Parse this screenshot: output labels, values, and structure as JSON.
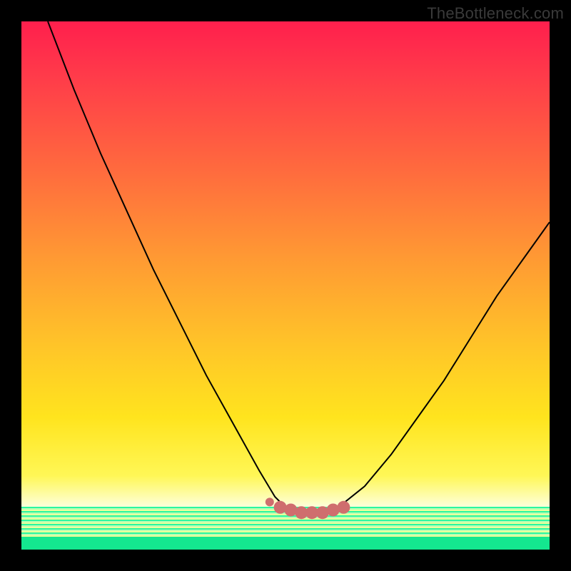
{
  "watermark": "TheBottleneck.com",
  "chart_data": {
    "type": "line",
    "title": "",
    "xlabel": "",
    "ylabel": "",
    "xlim": [
      0,
      100
    ],
    "ylim": [
      0,
      100
    ],
    "legend": false,
    "grid": false,
    "annotations": [],
    "background_gradient": {
      "stops": [
        {
          "pos": 0.0,
          "color": "#ff1f4d"
        },
        {
          "pos": 0.28,
          "color": "#ff6a3e"
        },
        {
          "pos": 0.62,
          "color": "#ffc628"
        },
        {
          "pos": 0.86,
          "color": "#fff756"
        },
        {
          "pos": 0.92,
          "color": "#fdffdc"
        },
        {
          "pos": 1.0,
          "color": "#14e78f"
        }
      ]
    },
    "series": [
      {
        "name": "bottleneck-curve",
        "color": "#000000",
        "x": [
          5,
          10,
          15,
          20,
          25,
          30,
          35,
          40,
          45,
          48,
          50,
          52,
          54,
          56,
          58,
          60,
          65,
          70,
          75,
          80,
          85,
          90,
          95,
          100
        ],
        "y": [
          100,
          87,
          75,
          64,
          53,
          43,
          33,
          24,
          15,
          10,
          8,
          7,
          7,
          7,
          7,
          8,
          12,
          18,
          25,
          32,
          40,
          48,
          55,
          62
        ]
      },
      {
        "name": "highlight-dots",
        "color": "#cf6e6e",
        "type": "scatter",
        "x": [
          47,
          49,
          51,
          53,
          55,
          57,
          59,
          61
        ],
        "y": [
          9,
          8,
          7.5,
          7,
          7,
          7,
          7.5,
          8
        ]
      }
    ]
  }
}
